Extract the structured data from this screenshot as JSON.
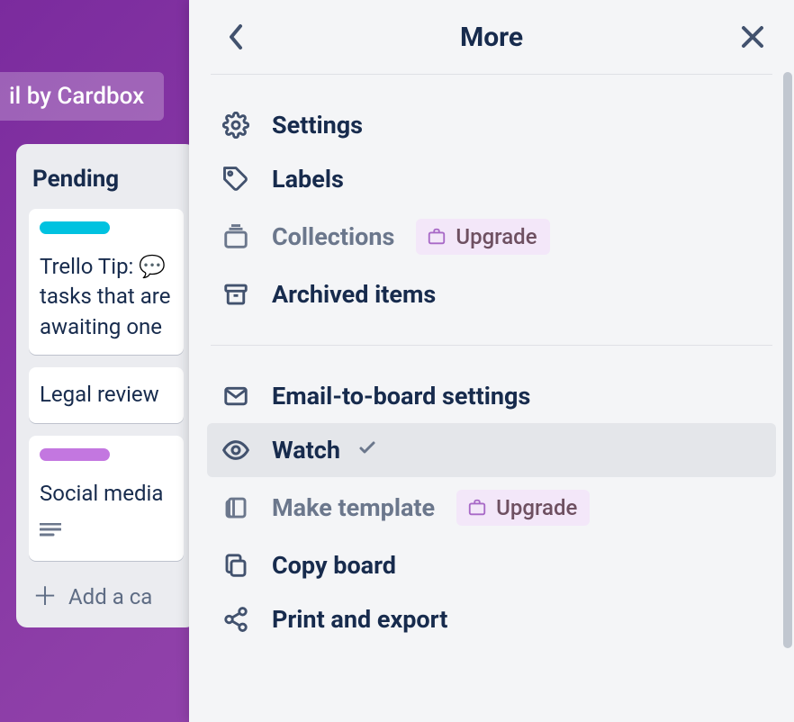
{
  "board": {
    "powerup_button": "il by Cardbox",
    "list_title": "Pending",
    "cards": [
      {
        "text": "Trello Tip: 💬 tasks that are awaiting one"
      },
      {
        "text": "Legal review"
      },
      {
        "text": "Social media"
      }
    ],
    "add_card": "Add a ca"
  },
  "panel": {
    "title": "More",
    "upgrade_label": "Upgrade",
    "section1": {
      "settings": "Settings",
      "labels": "Labels",
      "collections": "Collections",
      "archived": "Archived items"
    },
    "section2": {
      "email": "Email-to-board settings",
      "watch": "Watch",
      "make_template": "Make template",
      "copy_board": "Copy board",
      "print_export": "Print and export"
    }
  }
}
